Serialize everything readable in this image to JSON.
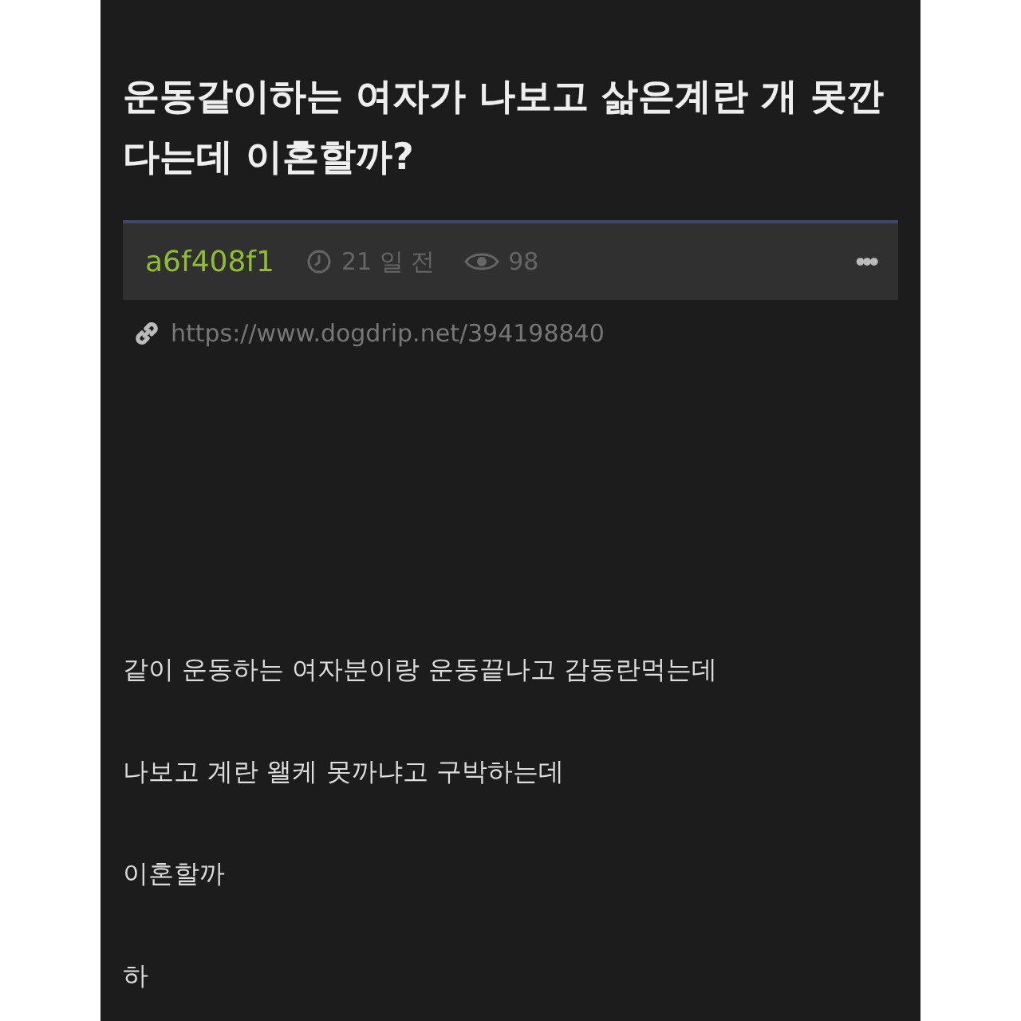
{
  "post": {
    "title": "운동같이하는 여자가 나보고 삶은계란 개 못깐다는데 이혼할까?",
    "author": "a6f408f1",
    "time": "21 일 전",
    "views": "98",
    "more": "•••",
    "link": "https://www.dogdrip.net/394198840",
    "paragraphs": [
      "같이 운동하는 여자분이랑 운동끝나고 감동란먹는데",
      "나보고 계란 왤케 못까냐고 구박하는데",
      "이혼할까",
      "하"
    ]
  }
}
